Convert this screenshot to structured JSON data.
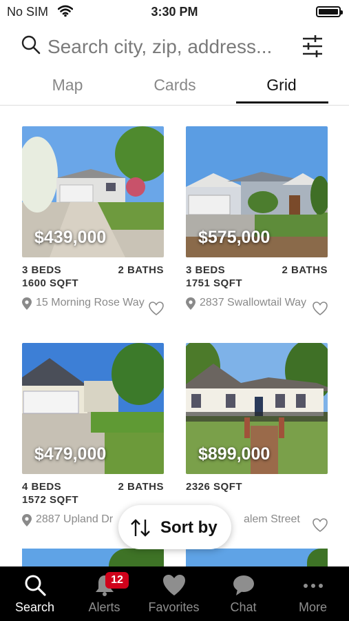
{
  "status_bar": {
    "carrier": "No SIM",
    "time": "3:30 PM"
  },
  "search": {
    "placeholder": "Search city, zip, address..."
  },
  "tabs": [
    {
      "label": "Map",
      "active": false
    },
    {
      "label": "Cards",
      "active": false
    },
    {
      "label": "Grid",
      "active": true
    }
  ],
  "listings": [
    {
      "price": "$439,000",
      "beds": "3 BEDS",
      "baths": "2 BATHS",
      "sqft": "1600 SQFT",
      "address": "15 Morning Rose Way"
    },
    {
      "price": "$575,000",
      "beds": "3 BEDS",
      "baths": "2 BATHS",
      "sqft": "1751 SQFT",
      "address": "2837 Swallowtail Way"
    },
    {
      "price": "$479,000",
      "beds": "4 BEDS",
      "baths": "2 BATHS",
      "sqft": "1572 SQFT",
      "address": "2887 Upland Dr"
    },
    {
      "price": "$899,000",
      "beds": "",
      "baths": "",
      "sqft": "2326 SQFT",
      "address": "alem Street"
    }
  ],
  "sort": {
    "label": "Sort by"
  },
  "tab_bar": {
    "items": [
      {
        "label": "Search",
        "icon": "search-icon",
        "active": true
      },
      {
        "label": "Alerts",
        "icon": "bell-icon",
        "badge": "12"
      },
      {
        "label": "Favorites",
        "icon": "heart-icon"
      },
      {
        "label": "Chat",
        "icon": "chat-bubble-icon"
      },
      {
        "label": "More",
        "icon": "more-dots-icon"
      }
    ]
  },
  "colors": {
    "accent": "#111111",
    "badge": "#d0021b",
    "tabbar_bg": "#000000"
  }
}
